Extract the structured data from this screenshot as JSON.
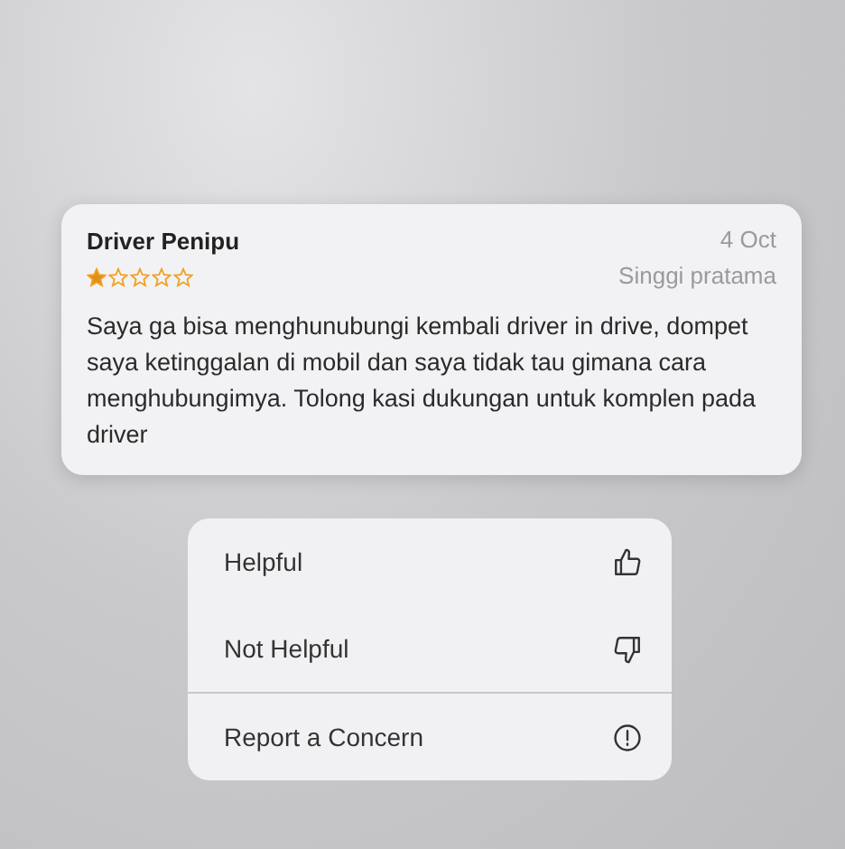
{
  "review": {
    "title": "Driver Penipu",
    "date": "4 Oct",
    "stars": 1,
    "author": "Singgi pratama",
    "body": "Saya ga bisa menghunubungi kembali driver in drive, dompet saya ketinggalan di mobil dan saya tidak tau gimana cara menghubungimya. Tolong kasi dukungan untuk komplen pada driver"
  },
  "menu": {
    "groups": [
      [
        {
          "label": "Helpful",
          "kind": "thumbs-up"
        },
        {
          "label": "Not Helpful",
          "kind": "thumbs-down"
        }
      ],
      [
        {
          "label": "Report a Concern",
          "kind": "alert"
        }
      ]
    ]
  }
}
